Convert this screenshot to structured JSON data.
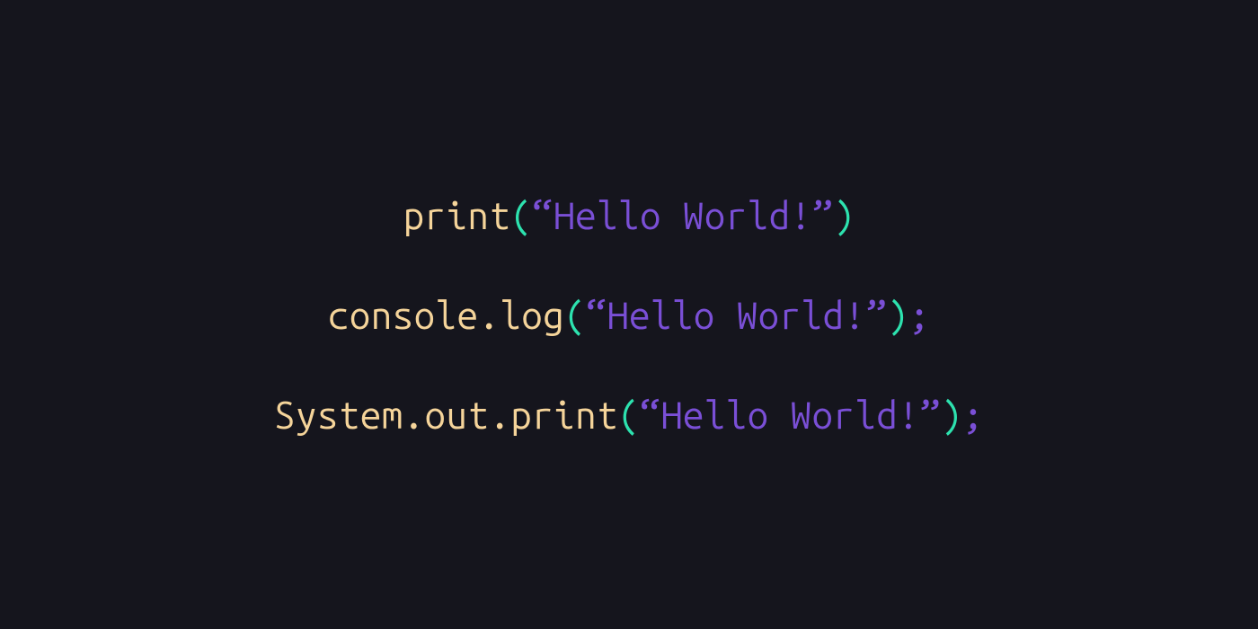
{
  "colors": {
    "background": "#15151d",
    "function": "#f5d49a",
    "paren": "#2de2af",
    "string": "#7a4fd6"
  },
  "lines": [
    {
      "fn": "print",
      "open_paren": "(",
      "string": "“Hello World!”",
      "close_paren": ")",
      "semi": ""
    },
    {
      "fn": "console.log",
      "open_paren": "(",
      "string": "“Hello World!”",
      "close_paren": ")",
      "semi": ";"
    },
    {
      "fn": "System.out.print",
      "open_paren": "(",
      "string": "“Hello World!”",
      "close_paren": ")",
      "semi": ";"
    }
  ]
}
